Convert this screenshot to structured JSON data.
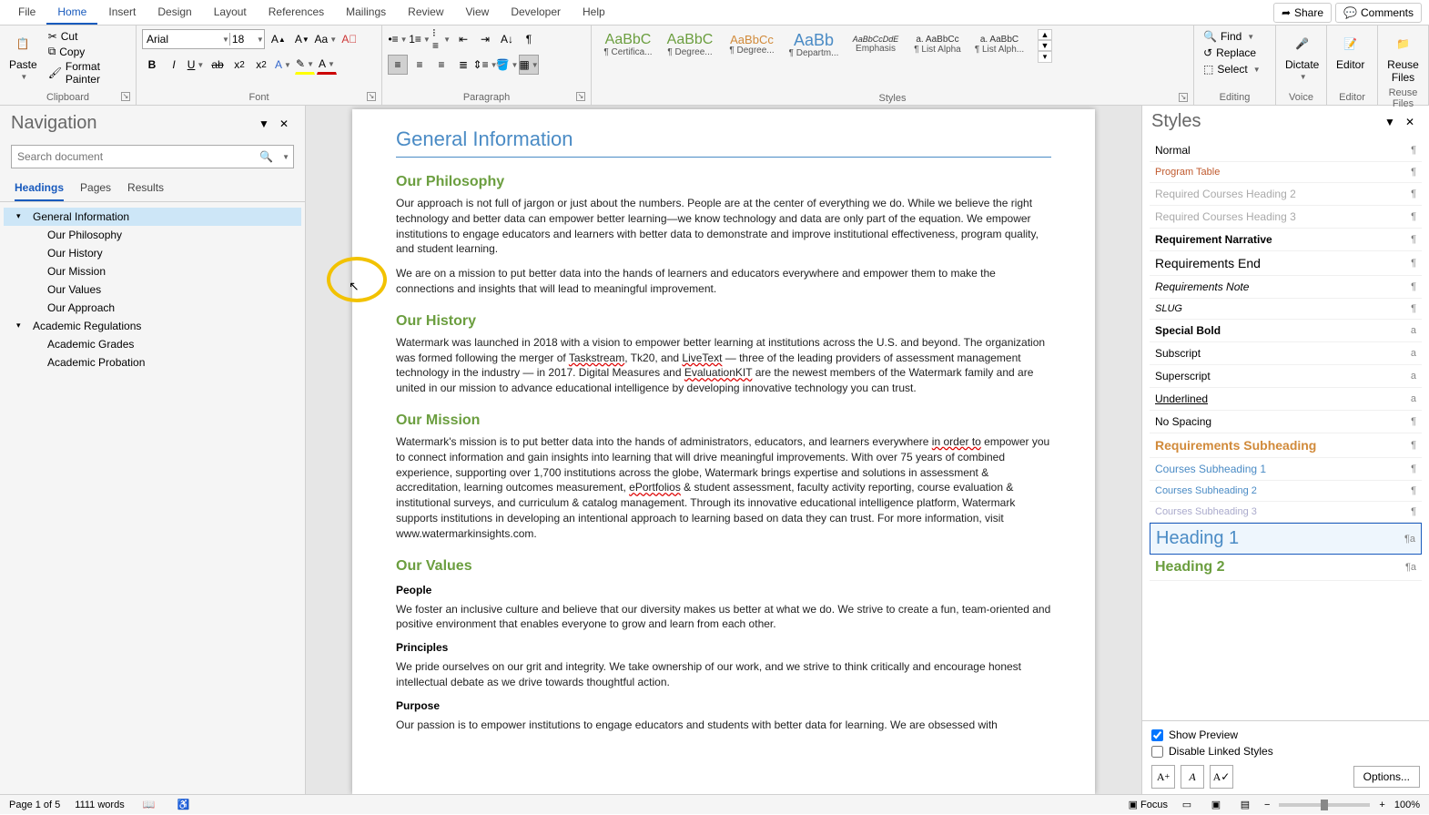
{
  "menubar": {
    "items": [
      "File",
      "Home",
      "Insert",
      "Design",
      "Layout",
      "References",
      "Mailings",
      "Review",
      "View",
      "Developer",
      "Help"
    ],
    "active_index": 1,
    "share": "Share",
    "comments": "Comments"
  },
  "ribbon": {
    "clipboard": {
      "label": "Clipboard",
      "paste": "Paste",
      "cut": "Cut",
      "copy": "Copy",
      "format_painter": "Format Painter"
    },
    "font": {
      "label": "Font",
      "name": "Arial",
      "size": "18"
    },
    "paragraph": {
      "label": "Paragraph"
    },
    "styles": {
      "label": "Styles",
      "tiles": [
        {
          "sample": "AaBbC",
          "name": "¶ Certifica...",
          "color": "#6b9e3f",
          "size": "16px"
        },
        {
          "sample": "AaBbC",
          "name": "¶ Degree...",
          "color": "#6b9e3f",
          "size": "16px",
          "weight": "300"
        },
        {
          "sample": "AaBbCc",
          "name": "¶ Degree...",
          "color": "#d18a3a",
          "size": "13px"
        },
        {
          "sample": "AaBb",
          "name": "¶ Departm...",
          "color": "#4a8bc5",
          "size": "18px"
        },
        {
          "sample": "AaBbCcDdE",
          "name": "Emphasis",
          "color": "#333",
          "style": "italic",
          "size": "9px"
        },
        {
          "sample": "a. AaBbCc",
          "name": "¶ List Alpha",
          "color": "#333",
          "size": "10px"
        },
        {
          "sample": "a. AaBbC",
          "name": "¶ List Alph...",
          "color": "#333",
          "size": "10px"
        }
      ]
    },
    "editing": {
      "label": "Editing",
      "find": "Find",
      "replace": "Replace",
      "select": "Select"
    },
    "voice": {
      "label": "Voice",
      "dictate": "Dictate"
    },
    "editor": {
      "label": "Editor",
      "editor": "Editor"
    },
    "reuse": {
      "label": "Reuse Files",
      "reuse": "Reuse Files"
    }
  },
  "navpane": {
    "title": "Navigation",
    "search_placeholder": "Search document",
    "tabs": [
      "Headings",
      "Pages",
      "Results"
    ],
    "active_tab": 0,
    "tree": [
      {
        "label": "General Information",
        "level": 0,
        "active": true,
        "expanded": true
      },
      {
        "label": "Our Philosophy",
        "level": 1
      },
      {
        "label": "Our History",
        "level": 1
      },
      {
        "label": "Our Mission",
        "level": 1
      },
      {
        "label": "Our Values",
        "level": 1
      },
      {
        "label": "Our Approach",
        "level": 1
      },
      {
        "label": "Academic Regulations",
        "level": 0,
        "expanded": true
      },
      {
        "label": "Academic Grades",
        "level": 1
      },
      {
        "label": "Academic Probation",
        "level": 1
      }
    ]
  },
  "document": {
    "h1": "General Information",
    "sections": [
      {
        "h2": "Our Philosophy",
        "paras": [
          "Our approach is not full of jargon or just about the numbers. People are at the center of everything we do. While we believe the right technology and better data can empower better learning—we know technology and data are only part of the equation. We empower institutions to engage educators and learners with better data to demonstrate and improve institutional effectiveness, program quality, and student learning.",
          "We are on a mission to put better data into the hands of learners and educators everywhere and empower them to make the connections and insights that will lead to meaningful improvement."
        ]
      },
      {
        "h2": "Our History",
        "paras": [
          "Watermark was launched in 2018 with a vision to empower better learning at institutions across the U.S. and beyond. The organization was formed following the merger of Taskstream, Tk20, and LiveText — three of the leading providers of assessment management technology in the industry — in 2017. Digital Measures and EvaluationKIT are the newest members of the Watermark family and are united in our mission to advance educational intelligence by developing innovative technology you can trust."
        ]
      },
      {
        "h2": "Our Mission",
        "paras": [
          "Watermark's mission is to put better data into the hands of administrators, educators, and learners everywhere in order to empower you to connect information and gain insights into learning that will drive meaningful improvements. With over 75 years of combined experience, supporting over 1,700 institutions across the globe, Watermark brings expertise and solutions in assessment & accreditation, learning outcomes measurement, ePortfolios & student assessment, faculty activity reporting, course evaluation & institutional surveys, and curriculum & catalog management. Through its innovative educational intelligence platform, Watermark supports institutions in developing an intentional approach to learning based on data they can trust. For more information, visit www.watermarkinsights.com."
        ]
      },
      {
        "h2": "Our Values",
        "subs": [
          {
            "h3": "People",
            "p": "We foster an inclusive culture and believe that our diversity makes us better at what we do. We strive to create a fun, team-oriented and positive environment that enables everyone to grow and learn from each other."
          },
          {
            "h3": "Principles",
            "p": "We pride ourselves on our grit and integrity. We take ownership of our work, and we strive to think critically and encourage honest intellectual debate as we drive towards thoughtful action."
          },
          {
            "h3": "Purpose",
            "p": "Our passion is to empower institutions to engage educators and students with better data for learning. We are obsessed with"
          }
        ]
      }
    ]
  },
  "stylespane": {
    "title": "Styles",
    "items": [
      {
        "name": "Normal",
        "sym": "¶"
      },
      {
        "name": "Program Table",
        "sym": "¶",
        "color": "#c05a2e",
        "size": "11px"
      },
      {
        "name": "Required Courses Heading 2",
        "sym": "¶",
        "color": "#aaa"
      },
      {
        "name": "Required Courses Heading 3",
        "sym": "¶",
        "color": "#aaa"
      },
      {
        "name": "Requirement Narrative",
        "sym": "¶",
        "weight": "700"
      },
      {
        "name": "Requirements End",
        "sym": "¶",
        "size": "14px"
      },
      {
        "name": "Requirements Note",
        "sym": "¶",
        "style": "italic"
      },
      {
        "name": "SLUG",
        "sym": "¶",
        "style": "italic",
        "size": "11px"
      },
      {
        "name": "Special Bold",
        "sym": "a",
        "weight": "700"
      },
      {
        "name": "Subscript",
        "sym": "a"
      },
      {
        "name": "Superscript",
        "sym": "a"
      },
      {
        "name": "Underlined",
        "sym": "a",
        "decoration": "underline"
      },
      {
        "name": "No Spacing",
        "sym": "¶"
      },
      {
        "name": "Requirements Subheading",
        "sym": "¶",
        "color": "#d18a3a",
        "weight": "700",
        "size": "14px"
      },
      {
        "name": "Courses Subheading 1",
        "sym": "¶",
        "color": "#4a8bc5"
      },
      {
        "name": "Courses Subheading 2",
        "sym": "¶",
        "color": "#4a8bc5",
        "size": "11px"
      },
      {
        "name": "Courses Subheading 3",
        "sym": "¶",
        "color": "#aac",
        "size": "11px"
      },
      {
        "name": "Heading 1",
        "sym": "¶a",
        "color": "#4a8bc5",
        "size": "20px",
        "selected": true
      },
      {
        "name": "Heading 2",
        "sym": "¶a",
        "color": "#6b9e3f",
        "size": "16px",
        "weight": "700"
      }
    ],
    "show_preview": "Show Preview",
    "disable_linked": "Disable Linked Styles",
    "options": "Options..."
  },
  "statusbar": {
    "page": "Page 1 of 5",
    "words": "1111 words",
    "focus": "Focus",
    "zoom": "100%"
  }
}
